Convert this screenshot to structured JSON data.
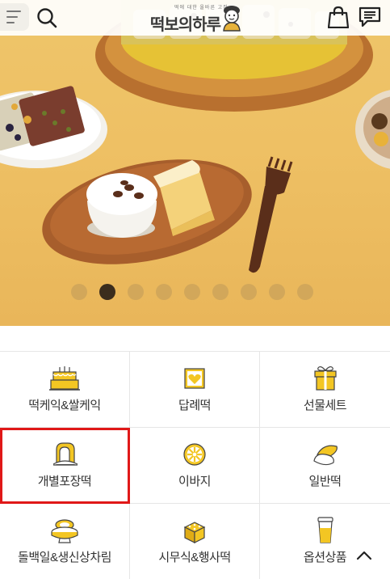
{
  "header": {
    "logo_tagline": "떡에 대한 올바른 고집",
    "logo_text": "떡보의하루",
    "icons": [
      "menu-icon",
      "search-icon",
      "shopping-bag-icon",
      "chat-icon"
    ]
  },
  "banner": {
    "slide_count": 9,
    "active_slide": 2
  },
  "categories": [
    {
      "label": "떡케익&쌀케익",
      "icon": "cake-icon"
    },
    {
      "label": "답례떡",
      "icon": "heart-box-icon"
    },
    {
      "label": "선물세트",
      "icon": "gift-icon"
    },
    {
      "label": "개별포장떡",
      "icon": "wrapped-rice-cake-icon",
      "highlighted": true
    },
    {
      "label": "이바지",
      "icon": "orange-slice-icon"
    },
    {
      "label": "일반떡",
      "icon": "rice-cake-icon"
    },
    {
      "label": "돌백일&생신상차림",
      "icon": "table-setting-icon"
    },
    {
      "label": "시무식&행사떡",
      "icon": "tray-icon"
    },
    {
      "label": "옵션상품",
      "icon": "cup-icon"
    }
  ],
  "colors": {
    "accent_yellow": "#f3c623",
    "highlight_red": "#e01818",
    "banner_background": "#eec064"
  }
}
